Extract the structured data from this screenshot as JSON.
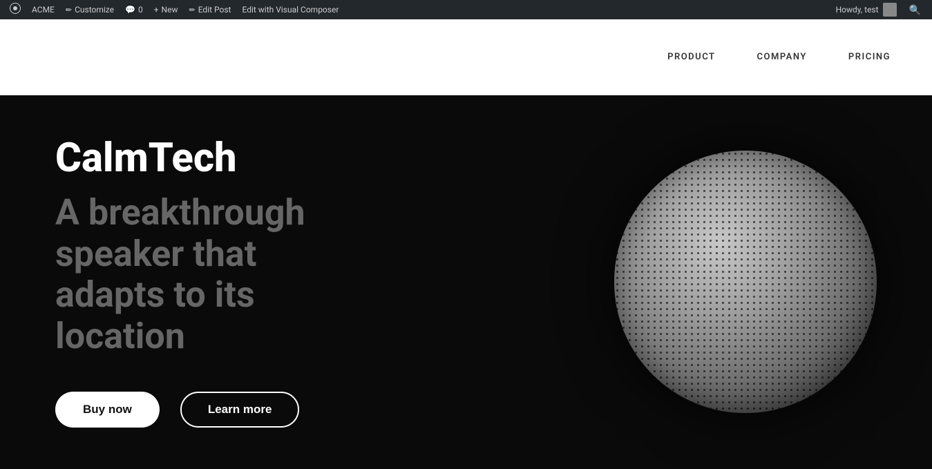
{
  "admin_bar": {
    "wp_icon": "⊕",
    "site_name": "ACME",
    "customize_label": "Customize",
    "comments_label": "0",
    "new_label": "New",
    "edit_post_label": "Edit Post",
    "visual_composer_label": "Edit with Visual Composer",
    "howdy_text": "Howdy, test",
    "search_title": "Search"
  },
  "nav": {
    "product_label": "PRODUCT",
    "company_label": "COMPANY",
    "pricing_label": "PRICING"
  },
  "hero": {
    "title": "CalmTech",
    "subtitle_line1": "A breakthrough",
    "subtitle_line2": "speaker that",
    "subtitle_line3": "adapts to its",
    "subtitle_line4": "location",
    "btn_buy": "Buy now",
    "btn_learn": "Learn more"
  }
}
